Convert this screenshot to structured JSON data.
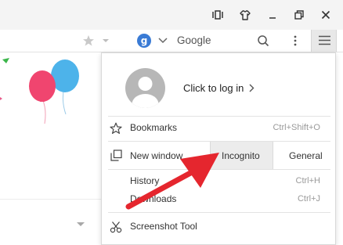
{
  "window_controls": {
    "icons": [
      "window-mode-icon",
      "skin-icon",
      "minimize-icon",
      "restore-icon",
      "close-icon"
    ]
  },
  "toolbar": {
    "search_engine_letter": "g",
    "search_engine_name": "Google"
  },
  "menu": {
    "login_label": "Click to log in",
    "items": {
      "bookmarks": {
        "label": "Bookmarks",
        "shortcut": "Ctrl+Shift+O"
      },
      "new_window": {
        "label": "New window",
        "incognito": "Incognito",
        "general": "General"
      },
      "history": {
        "label": "History",
        "shortcut": "Ctrl+H"
      },
      "downloads": {
        "label": "Downloads",
        "shortcut": "Ctrl+J"
      },
      "screenshot": {
        "label": "Screenshot Tool"
      }
    }
  },
  "colors": {
    "arrow": "#e5262e",
    "balloon_pink": "#f0456f",
    "balloon_blue": "#4db3ea",
    "accent_green": "#3bb54a",
    "google_badge": "#3a7bd5"
  }
}
